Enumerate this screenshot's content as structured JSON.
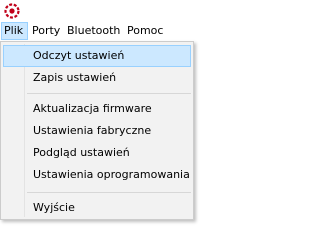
{
  "app": {
    "icon": "app-logo-icon",
    "accent": "#c0001a"
  },
  "menubar": {
    "items": [
      {
        "label": "Plik"
      },
      {
        "label": "Porty"
      },
      {
        "label": "Bluetooth"
      },
      {
        "label": "Pomoc"
      }
    ],
    "active_index": 0,
    "active_color": "#cce8ff"
  },
  "dropdown": {
    "items": [
      {
        "label": "Odczyt ustawień"
      },
      {
        "label": "Zapis ustawień"
      },
      {
        "label": "Aktualizacja firmware"
      },
      {
        "label": "Ustawienia fabryczne"
      },
      {
        "label": "Podgląd ustawień"
      },
      {
        "label": "Ustawienia oprogramowania"
      },
      {
        "label": "Wyjście"
      }
    ],
    "hovered_index": 0
  }
}
